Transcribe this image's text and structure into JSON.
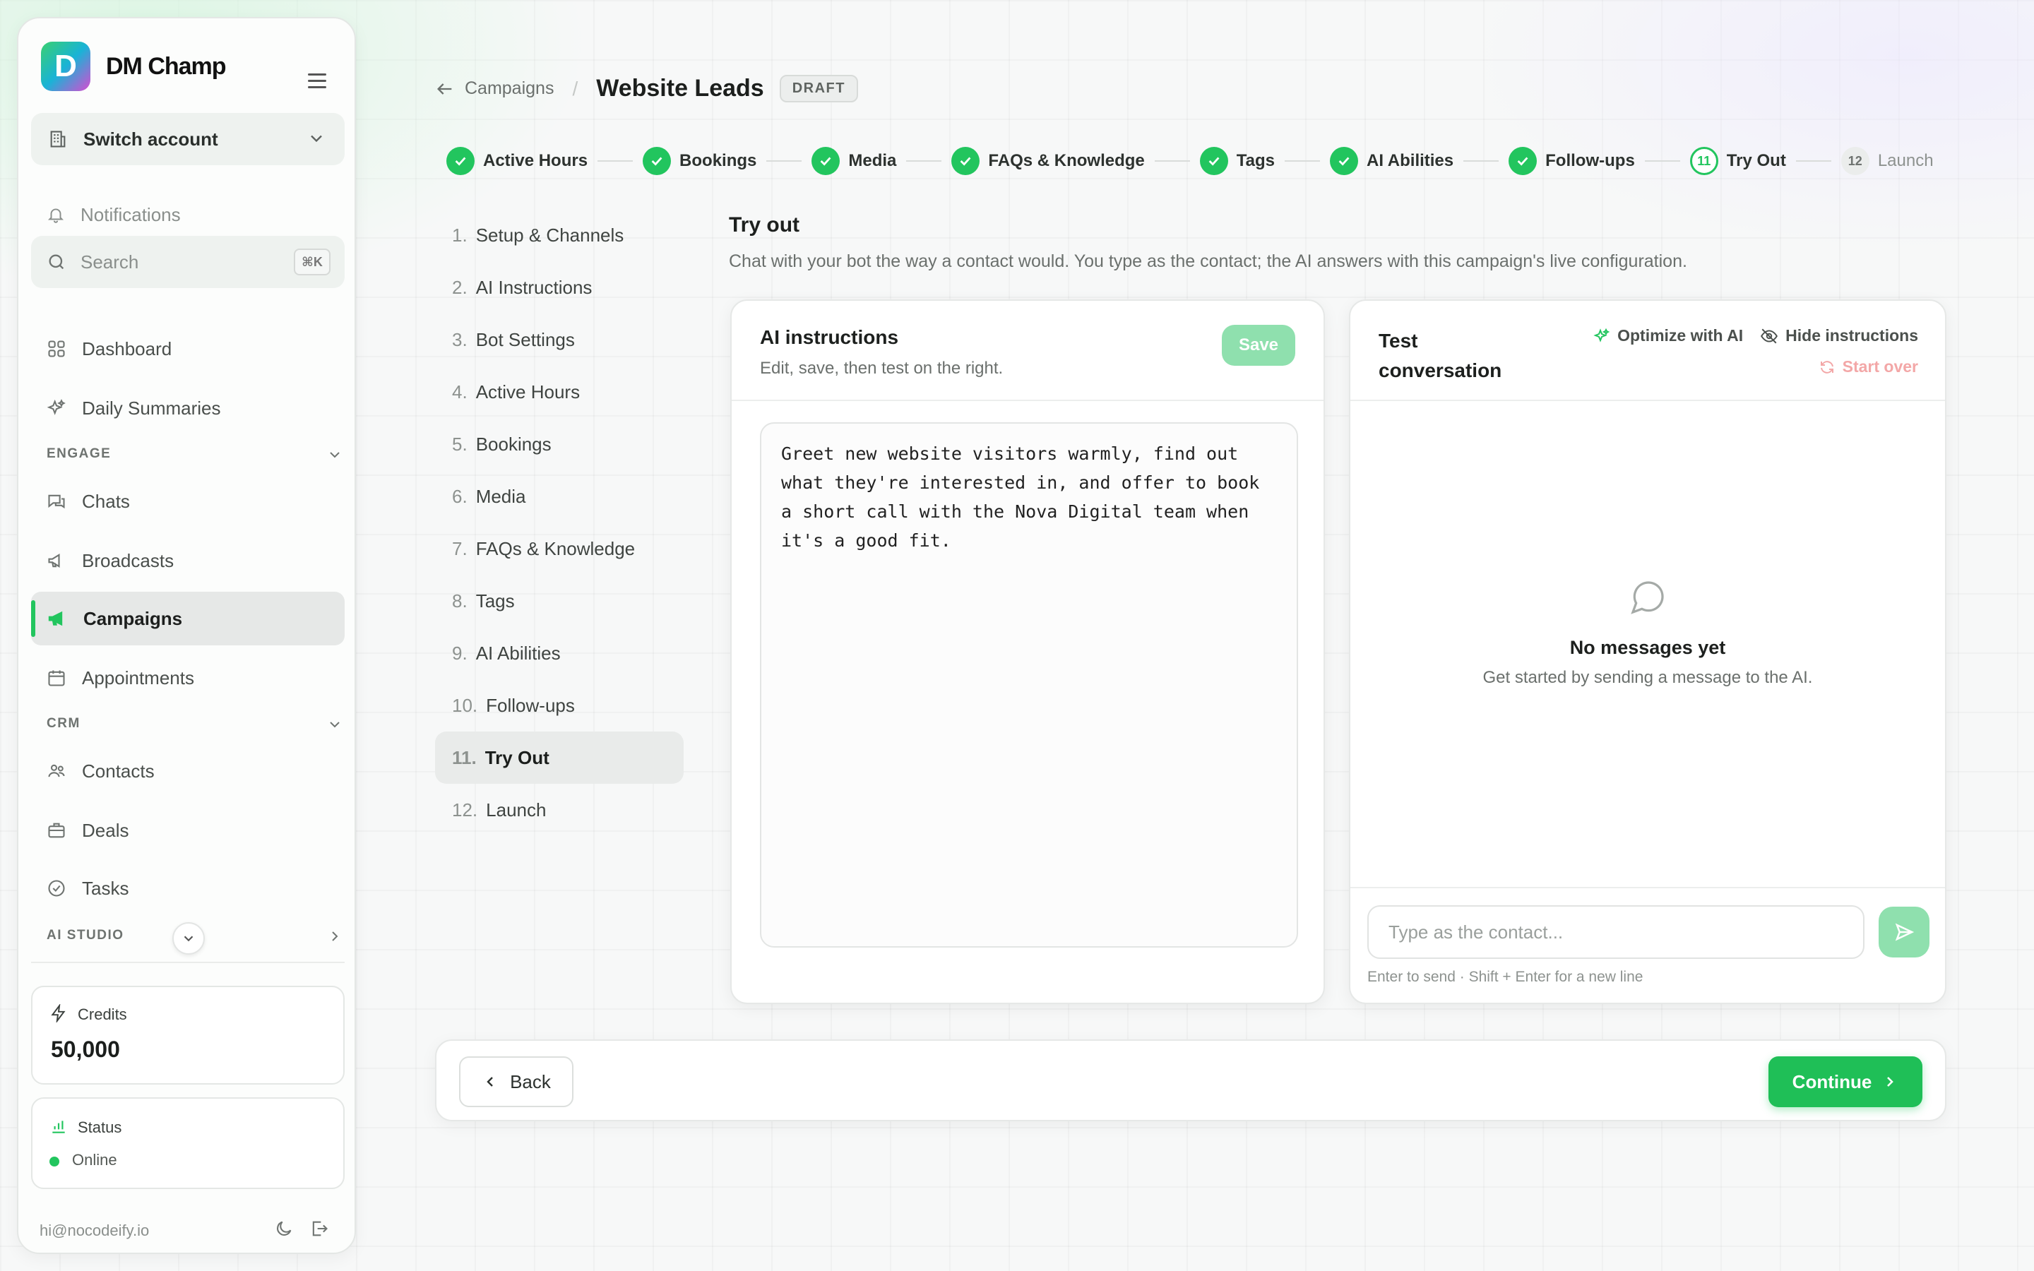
{
  "app": {
    "brand": "DM Champ"
  },
  "sidebar": {
    "switch_account": "Switch account",
    "notifications": "Notifications",
    "search_label": "Search",
    "search_shortcut": "⌘K",
    "dashboard": "Dashboard",
    "daily_summaries": "Daily Summaries",
    "engage_section": "ENGAGE",
    "chats": "Chats",
    "broadcasts": "Broadcasts",
    "campaigns": "Campaigns",
    "appointments": "Appointments",
    "crm_section": "CRM",
    "contacts": "Contacts",
    "deals": "Deals",
    "tasks": "Tasks",
    "ai_studio_section": "AI STUDIO",
    "credits_label": "Credits",
    "credits_value": "50,000",
    "status_label": "Status",
    "status_value": "Online",
    "user_email": "hi@nocodeify.io"
  },
  "header": {
    "back_label": "Campaigns",
    "separator": "/",
    "title": "Website Leads",
    "badge": "DRAFT"
  },
  "stepper": [
    {
      "label": "Active Hours",
      "state": "done"
    },
    {
      "label": "Bookings",
      "state": "done"
    },
    {
      "label": "Media",
      "state": "done"
    },
    {
      "label": "FAQs & Knowledge",
      "state": "done"
    },
    {
      "label": "Tags",
      "state": "done"
    },
    {
      "label": "AI Abilities",
      "state": "done"
    },
    {
      "label": "Follow-ups",
      "state": "done"
    },
    {
      "label": "Try Out",
      "state": "current",
      "number": "11"
    },
    {
      "label": "Launch",
      "state": "future",
      "number": "12"
    }
  ],
  "steps": [
    {
      "n": "1.",
      "label": "Setup & Channels"
    },
    {
      "n": "2.",
      "label": "AI Instructions"
    },
    {
      "n": "3.",
      "label": "Bot Settings"
    },
    {
      "n": "4.",
      "label": "Active Hours"
    },
    {
      "n": "5.",
      "label": "Bookings"
    },
    {
      "n": "6.",
      "label": "Media"
    },
    {
      "n": "7.",
      "label": "FAQs & Knowledge"
    },
    {
      "n": "8.",
      "label": "Tags"
    },
    {
      "n": "9.",
      "label": "AI Abilities"
    },
    {
      "n": "10.",
      "label": "Follow-ups"
    },
    {
      "n": "11.",
      "label": "Try Out"
    },
    {
      "n": "12.",
      "label": "Launch"
    }
  ],
  "main": {
    "heading": "Try out",
    "subheading": "Chat with your bot the way a contact would. You type as the contact; the AI answers with this campaign's live configuration."
  },
  "ai_panel": {
    "title": "AI instructions",
    "subtitle": "Edit, save, then test on the right.",
    "save_label": "Save",
    "instructions": "Greet new website visitors warmly, find out what they're interested in, and offer to book a short call with the Nova Digital team when it's a good fit."
  },
  "test_panel": {
    "title": "Test conversation",
    "optimize_label": "Optimize with AI",
    "hide_label": "Hide instructions",
    "start_over_label": "Start over",
    "empty_title": "No messages yet",
    "empty_sub": "Get started by sending a message to the AI.",
    "input_placeholder": "Type as the contact...",
    "hint": "Enter to send · Shift + Enter for a new line"
  },
  "footer_bar": {
    "back_label": "Back",
    "continue_label": "Continue"
  },
  "colors": {
    "accent": "#22c55e",
    "accent_muted": "#8fe0ae",
    "warning_muted": "#f3a7a7"
  }
}
